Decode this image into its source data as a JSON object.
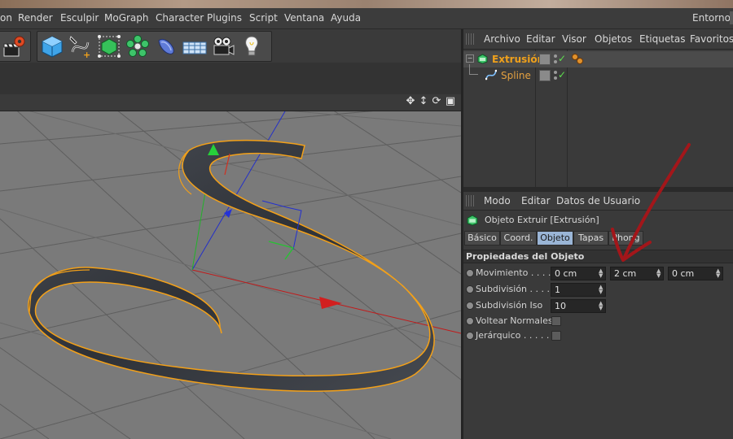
{
  "menubar": {
    "items": [
      "on",
      "Render",
      "Esculpir",
      "MoGraph",
      "Character",
      "Plugins",
      "Script",
      "Ventana",
      "Ayuda"
    ],
    "environment_label": "Entorno:"
  },
  "toolbar": {
    "groups": [
      {
        "tools": [
          "render-settings-icon"
        ]
      },
      {
        "tools": [
          "cube-icon",
          "spline-pen-icon",
          "subdivision-icon",
          "mograph-cloner-icon",
          "deformer-icon",
          "floor-grid-icon",
          "camera-icon",
          "light-bulb-icon"
        ]
      }
    ]
  },
  "viewport": {
    "nav_icons": [
      "move-view-icon",
      "zoom-view-icon",
      "rotate-view-icon",
      "maximize-view-icon"
    ],
    "nav_glyphs": [
      "✥",
      "↕",
      "⟳",
      "▣"
    ]
  },
  "object_manager": {
    "menu": [
      "Archivo",
      "Editar",
      "Visor",
      "Objetos",
      "Etiquetas",
      "Favoritos"
    ],
    "objects": [
      {
        "name": "Extrusión",
        "color": "#f0a11b",
        "selected": true,
        "enabled_check": "✓",
        "tag": "phong-tag"
      },
      {
        "name": "Spline",
        "color": "#e3a040",
        "selected": false,
        "enabled_check": "✓",
        "tag": ""
      }
    ]
  },
  "attribute_manager": {
    "menu": [
      "Modo",
      "Editar",
      "Datos de Usuario"
    ],
    "object_title": "Objeto Extruir [Extrusión]",
    "tabs": [
      {
        "label": "Básico",
        "active": false
      },
      {
        "label": "Coord.",
        "active": false
      },
      {
        "label": "Objeto",
        "active": true
      },
      {
        "label": "Tapas",
        "active": false
      },
      {
        "label": "Phong",
        "active": false
      }
    ],
    "section_title": "Propiedades del Objeto",
    "properties": {
      "movimiento": {
        "label": "Movimiento . . . .",
        "x": "0 cm",
        "y": "2 cm",
        "z": "0 cm"
      },
      "subdivision": {
        "label": "Subdivisión . . . .",
        "value": "1"
      },
      "subdivision_iso": {
        "label": "Subdivisión Iso",
        "value": "10"
      },
      "voltear_normales": {
        "label": "Voltear Normales",
        "checked": false
      },
      "jerarquico": {
        "label": "Jerárquico . . . . .",
        "checked": false
      }
    }
  },
  "colors": {
    "accent_selection": "#9ab5d6",
    "object_orange": "#f0a11b",
    "annotation_arrow": "#a3161a",
    "enabled_green": "#5fe04f"
  }
}
